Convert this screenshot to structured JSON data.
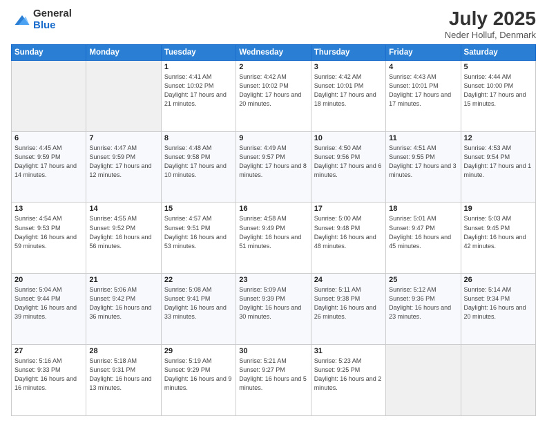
{
  "logo": {
    "general": "General",
    "blue": "Blue"
  },
  "title": "July 2025",
  "subtitle": "Neder Holluf, Denmark",
  "days_header": [
    "Sunday",
    "Monday",
    "Tuesday",
    "Wednesday",
    "Thursday",
    "Friday",
    "Saturday"
  ],
  "weeks": [
    [
      {
        "day": "",
        "sunrise": "",
        "sunset": "",
        "daylight": ""
      },
      {
        "day": "",
        "sunrise": "",
        "sunset": "",
        "daylight": ""
      },
      {
        "day": "1",
        "sunrise": "Sunrise: 4:41 AM",
        "sunset": "Sunset: 10:02 PM",
        "daylight": "Daylight: 17 hours and 21 minutes."
      },
      {
        "day": "2",
        "sunrise": "Sunrise: 4:42 AM",
        "sunset": "Sunset: 10:02 PM",
        "daylight": "Daylight: 17 hours and 20 minutes."
      },
      {
        "day": "3",
        "sunrise": "Sunrise: 4:42 AM",
        "sunset": "Sunset: 10:01 PM",
        "daylight": "Daylight: 17 hours and 18 minutes."
      },
      {
        "day": "4",
        "sunrise": "Sunrise: 4:43 AM",
        "sunset": "Sunset: 10:01 PM",
        "daylight": "Daylight: 17 hours and 17 minutes."
      },
      {
        "day": "5",
        "sunrise": "Sunrise: 4:44 AM",
        "sunset": "Sunset: 10:00 PM",
        "daylight": "Daylight: 17 hours and 15 minutes."
      }
    ],
    [
      {
        "day": "6",
        "sunrise": "Sunrise: 4:45 AM",
        "sunset": "Sunset: 9:59 PM",
        "daylight": "Daylight: 17 hours and 14 minutes."
      },
      {
        "day": "7",
        "sunrise": "Sunrise: 4:47 AM",
        "sunset": "Sunset: 9:59 PM",
        "daylight": "Daylight: 17 hours and 12 minutes."
      },
      {
        "day": "8",
        "sunrise": "Sunrise: 4:48 AM",
        "sunset": "Sunset: 9:58 PM",
        "daylight": "Daylight: 17 hours and 10 minutes."
      },
      {
        "day": "9",
        "sunrise": "Sunrise: 4:49 AM",
        "sunset": "Sunset: 9:57 PM",
        "daylight": "Daylight: 17 hours and 8 minutes."
      },
      {
        "day": "10",
        "sunrise": "Sunrise: 4:50 AM",
        "sunset": "Sunset: 9:56 PM",
        "daylight": "Daylight: 17 hours and 6 minutes."
      },
      {
        "day": "11",
        "sunrise": "Sunrise: 4:51 AM",
        "sunset": "Sunset: 9:55 PM",
        "daylight": "Daylight: 17 hours and 3 minutes."
      },
      {
        "day": "12",
        "sunrise": "Sunrise: 4:53 AM",
        "sunset": "Sunset: 9:54 PM",
        "daylight": "Daylight: 17 hours and 1 minute."
      }
    ],
    [
      {
        "day": "13",
        "sunrise": "Sunrise: 4:54 AM",
        "sunset": "Sunset: 9:53 PM",
        "daylight": "Daylight: 16 hours and 59 minutes."
      },
      {
        "day": "14",
        "sunrise": "Sunrise: 4:55 AM",
        "sunset": "Sunset: 9:52 PM",
        "daylight": "Daylight: 16 hours and 56 minutes."
      },
      {
        "day": "15",
        "sunrise": "Sunrise: 4:57 AM",
        "sunset": "Sunset: 9:51 PM",
        "daylight": "Daylight: 16 hours and 53 minutes."
      },
      {
        "day": "16",
        "sunrise": "Sunrise: 4:58 AM",
        "sunset": "Sunset: 9:49 PM",
        "daylight": "Daylight: 16 hours and 51 minutes."
      },
      {
        "day": "17",
        "sunrise": "Sunrise: 5:00 AM",
        "sunset": "Sunset: 9:48 PM",
        "daylight": "Daylight: 16 hours and 48 minutes."
      },
      {
        "day": "18",
        "sunrise": "Sunrise: 5:01 AM",
        "sunset": "Sunset: 9:47 PM",
        "daylight": "Daylight: 16 hours and 45 minutes."
      },
      {
        "day": "19",
        "sunrise": "Sunrise: 5:03 AM",
        "sunset": "Sunset: 9:45 PM",
        "daylight": "Daylight: 16 hours and 42 minutes."
      }
    ],
    [
      {
        "day": "20",
        "sunrise": "Sunrise: 5:04 AM",
        "sunset": "Sunset: 9:44 PM",
        "daylight": "Daylight: 16 hours and 39 minutes."
      },
      {
        "day": "21",
        "sunrise": "Sunrise: 5:06 AM",
        "sunset": "Sunset: 9:42 PM",
        "daylight": "Daylight: 16 hours and 36 minutes."
      },
      {
        "day": "22",
        "sunrise": "Sunrise: 5:08 AM",
        "sunset": "Sunset: 9:41 PM",
        "daylight": "Daylight: 16 hours and 33 minutes."
      },
      {
        "day": "23",
        "sunrise": "Sunrise: 5:09 AM",
        "sunset": "Sunset: 9:39 PM",
        "daylight": "Daylight: 16 hours and 30 minutes."
      },
      {
        "day": "24",
        "sunrise": "Sunrise: 5:11 AM",
        "sunset": "Sunset: 9:38 PM",
        "daylight": "Daylight: 16 hours and 26 minutes."
      },
      {
        "day": "25",
        "sunrise": "Sunrise: 5:12 AM",
        "sunset": "Sunset: 9:36 PM",
        "daylight": "Daylight: 16 hours and 23 minutes."
      },
      {
        "day": "26",
        "sunrise": "Sunrise: 5:14 AM",
        "sunset": "Sunset: 9:34 PM",
        "daylight": "Daylight: 16 hours and 20 minutes."
      }
    ],
    [
      {
        "day": "27",
        "sunrise": "Sunrise: 5:16 AM",
        "sunset": "Sunset: 9:33 PM",
        "daylight": "Daylight: 16 hours and 16 minutes."
      },
      {
        "day": "28",
        "sunrise": "Sunrise: 5:18 AM",
        "sunset": "Sunset: 9:31 PM",
        "daylight": "Daylight: 16 hours and 13 minutes."
      },
      {
        "day": "29",
        "sunrise": "Sunrise: 5:19 AM",
        "sunset": "Sunset: 9:29 PM",
        "daylight": "Daylight: 16 hours and 9 minutes."
      },
      {
        "day": "30",
        "sunrise": "Sunrise: 5:21 AM",
        "sunset": "Sunset: 9:27 PM",
        "daylight": "Daylight: 16 hours and 5 minutes."
      },
      {
        "day": "31",
        "sunrise": "Sunrise: 5:23 AM",
        "sunset": "Sunset: 9:25 PM",
        "daylight": "Daylight: 16 hours and 2 minutes."
      },
      {
        "day": "",
        "sunrise": "",
        "sunset": "",
        "daylight": ""
      },
      {
        "day": "",
        "sunrise": "",
        "sunset": "",
        "daylight": ""
      }
    ]
  ]
}
